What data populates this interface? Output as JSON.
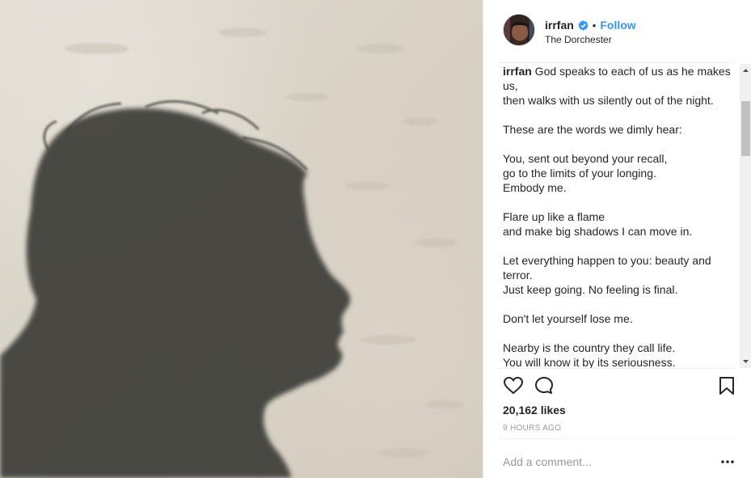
{
  "post": {
    "image_alt": "shadow-of-head-in-profile",
    "header": {
      "username": "irrfan",
      "verified_icon": "verified-badge-icon",
      "separator": "•",
      "follow_label": "Follow",
      "location": "The Dorchester"
    },
    "caption": {
      "username": "irrfan",
      "text": " God speaks to each of us as he makes us,\nthen walks with us silently out of the night.\n\nThese are the words we dimly hear:\n\nYou, sent out beyond your recall,\ngo to the limits of your longing.\nEmbody me.\n\nFlare up like a flame\nand make big shadows I can move in.\n\nLet everything happen to you: beauty and terror.\nJust keep going. No feeling is final.\n\nDon't let yourself lose me.\n\nNearby is the country they call life.\nYou will know it by its seriousness."
    },
    "actions": {
      "like_icon": "heart-icon",
      "comment_icon": "comment-icon",
      "save_icon": "bookmark-icon"
    },
    "likes": "20,162 likes",
    "time_ago": "9 HOURS AGO",
    "comment": {
      "placeholder": "Add a comment...",
      "more_icon": "more-options-icon"
    }
  },
  "colors": {
    "accent": "#3897f0",
    "text": "#262626",
    "muted": "#999999",
    "divider": "#efefef"
  }
}
